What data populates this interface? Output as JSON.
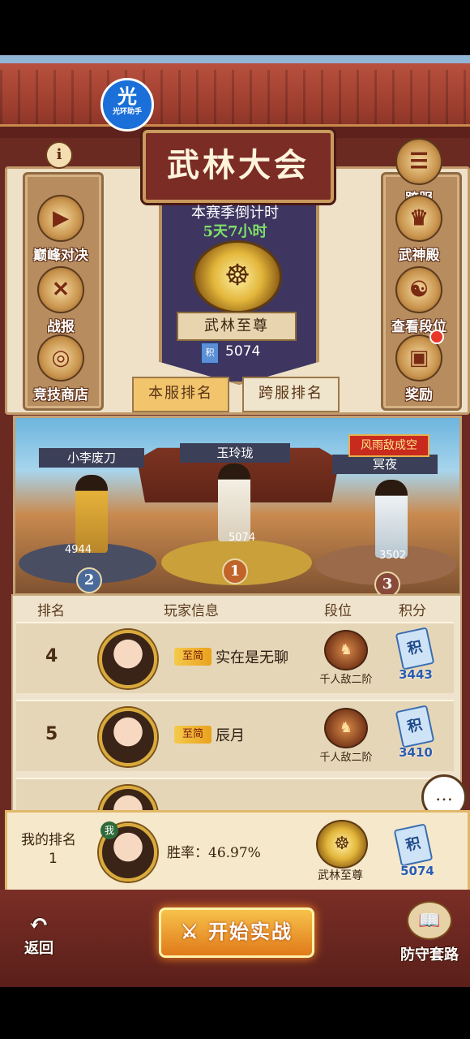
{
  "app_badge": {
    "glyph": "光",
    "label": "光环助手"
  },
  "title": "武林大会",
  "info_icon": "i",
  "season": {
    "countdown_label": "本赛季倒计时",
    "countdown_value": "5天7小时",
    "rank_title": "武林至尊",
    "score": "5074",
    "emblem_icon": "dragon-emblem"
  },
  "left_menu": [
    {
      "label": "巅峰对决",
      "icon": "▶"
    },
    {
      "label": "战报",
      "icon": "✕"
    },
    {
      "label": "竞技商店",
      "icon": "◎"
    }
  ],
  "right_menu": [
    {
      "label": "跨服",
      "icon": "☰"
    },
    {
      "label": "武神殿",
      "icon": "♛"
    },
    {
      "label": "查看段位",
      "icon": "☯"
    },
    {
      "label": "奖励",
      "icon": "▣"
    }
  ],
  "tabs": {
    "local": "本服排名",
    "cross": "跨服排名"
  },
  "podium": {
    "first": {
      "name": "玉玲珑",
      "score": "5074",
      "place": "1"
    },
    "second": {
      "name": "小李废刀",
      "score": "4944",
      "place": "2"
    },
    "third": {
      "name": "冥夜",
      "score": "3502",
      "place": "3",
      "tag": "风雨敌成空"
    }
  },
  "table": {
    "headers": {
      "rank": "排名",
      "info": "玩家信息",
      "tier": "段位",
      "points": "积分"
    },
    "rows": [
      {
        "rank": "4",
        "tier_tag": "至简",
        "name": "实在是无聊",
        "rank_name": "千人敌二阶",
        "points": "3443"
      },
      {
        "rank": "5",
        "tier_tag": "至简",
        "name": "辰月",
        "rank_name": "千人敌二阶",
        "points": "3410"
      }
    ],
    "points_icon": "积"
  },
  "my_rank": {
    "label": "我的排名",
    "value": "1",
    "tag": "我",
    "winrate": "胜率：46.97%",
    "rank_name": "武林至尊",
    "points": "5074"
  },
  "bottom": {
    "back": "返回",
    "start": "开始实战",
    "defense": "防守套路"
  },
  "colors": {
    "accent": "#7a2c25",
    "gold": "#f2c56d",
    "score_blue": "#2a5cb0",
    "countdown_green": "#7fe06a"
  }
}
